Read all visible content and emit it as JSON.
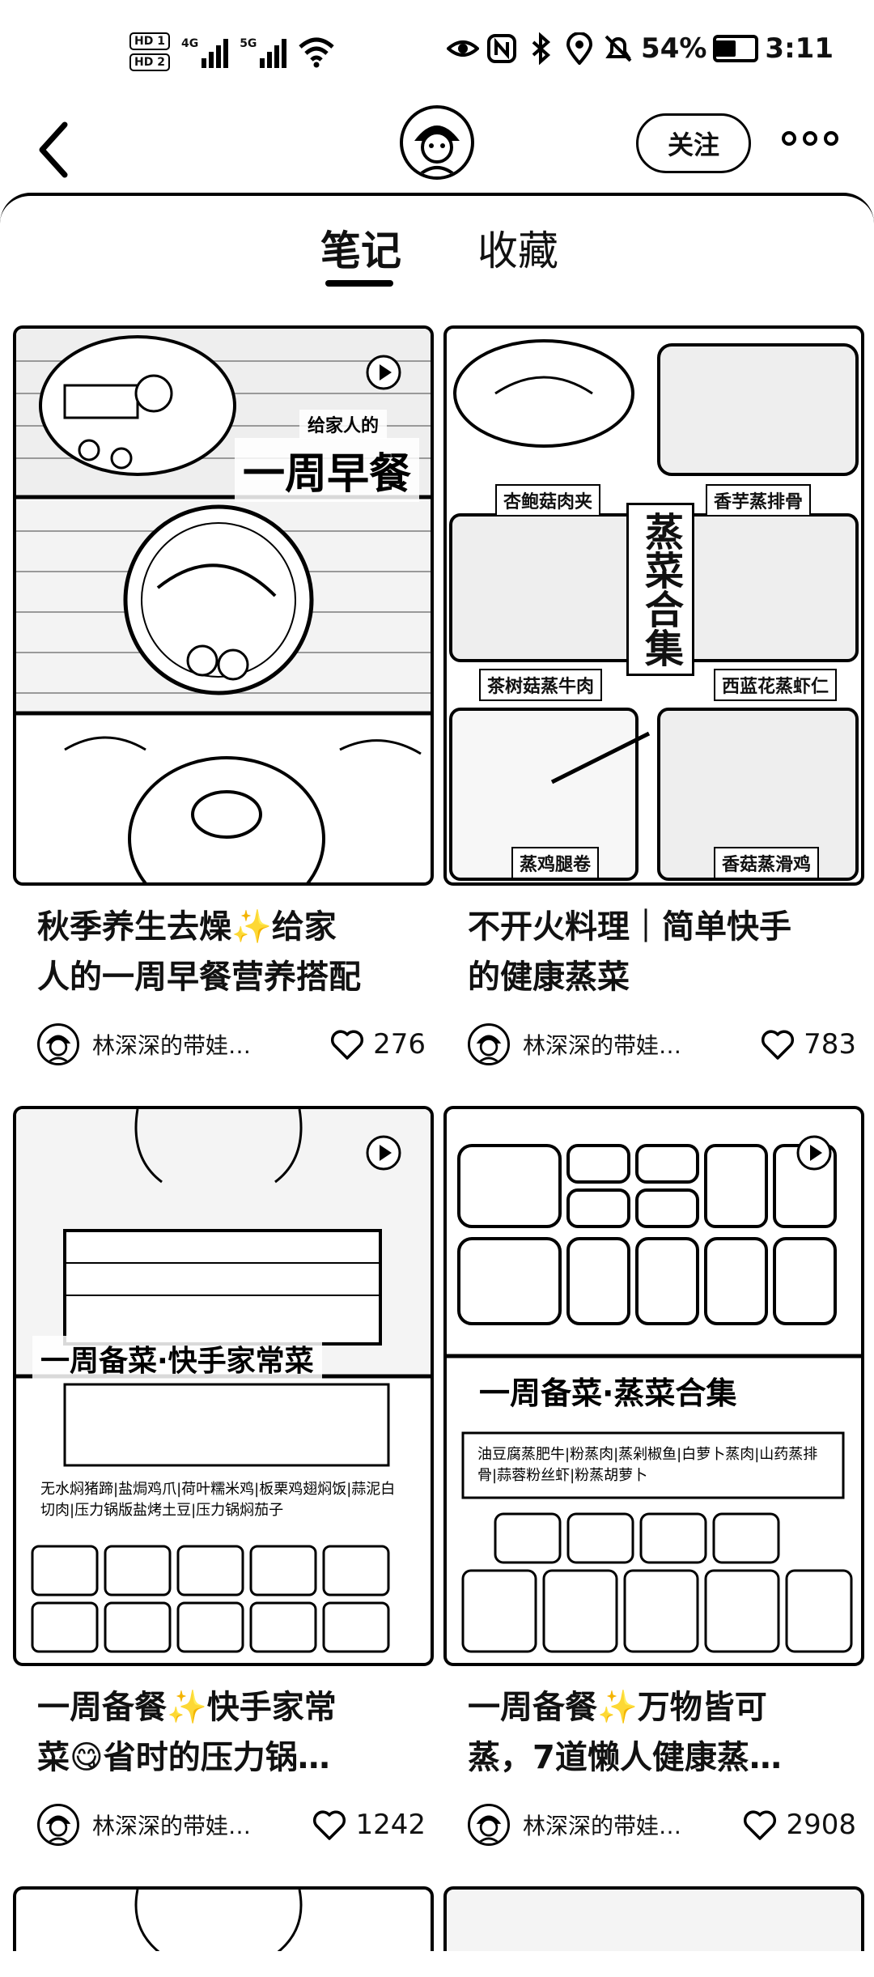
{
  "status_bar": {
    "hd1": "HD 1",
    "hd2": "HD 2",
    "net1": "4G",
    "net2": "5G",
    "battery_percent": "54%",
    "battery_level": 0.54,
    "time": "3:11"
  },
  "header": {
    "follow_label": "关注"
  },
  "tabs": [
    {
      "label": "笔记",
      "active": true
    },
    {
      "label": "收藏",
      "active": false
    }
  ],
  "cards": [
    {
      "title_line1": "秋季养生去燥✨给家",
      "title_line2": "人的一周早餐营养搭配",
      "author": "林深深的带娃…",
      "likes": "276",
      "overlay": "一周早餐",
      "overlay_small": "给家人的"
    },
    {
      "title_line1": "不开火料理｜简单快手",
      "title_line2": "的健康蒸菜",
      "author": "林深深的带娃…",
      "likes": "783",
      "overlay": "蒸菜合集",
      "captions": [
        "杏鲍菇肉夹",
        "香芋蒸排骨",
        "茶树菇蒸牛肉",
        "西蓝花蒸虾仁",
        "蒸鸡腿卷",
        "香菇蒸滑鸡"
      ]
    },
    {
      "title_line1": "一周备餐✨快手家常",
      "title_line2": "菜😋省时的压力锅…",
      "author": "林深深的带娃…",
      "likes": "1242",
      "overlay": "一周备菜·快手家常菜",
      "dish_list": "无水焖猪蹄|盐焗鸡爪|荷叶糯米鸡|板栗鸡翅焖饭|蒜泥白切肉|压力锅版盐烤土豆|压力锅焖茄子"
    },
    {
      "title_line1": "一周备餐✨万物皆可",
      "title_line2": "蒸，7道懒人健康蒸…",
      "author": "林深深的带娃…",
      "likes": "2908",
      "overlay": "一周备菜·蒸菜合集",
      "dish_list": "油豆腐蒸肥牛|粉蒸肉|蒸剁椒鱼|白萝卜蒸肉|山药蒸排骨|蒜蓉粉丝虾|粉蒸胡萝卜"
    }
  ],
  "colors": {
    "ink": "#000000",
    "paper": "#ffffff"
  },
  "icons": [
    "back-chevron-icon",
    "more-dots-icon",
    "heart-icon",
    "play-icon",
    "eye-icon",
    "nfc-icon",
    "bluetooth-icon",
    "location-icon",
    "mute-bell-icon",
    "wifi-icon",
    "signal-icon",
    "battery-icon"
  ]
}
